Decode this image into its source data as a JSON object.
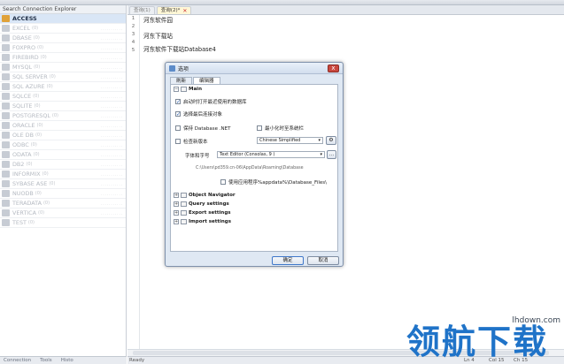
{
  "left_panel": {
    "title": "Search Connection Explorer",
    "items": [
      {
        "label": "ACCESS",
        "count": "",
        "selected": true,
        "tail": ""
      },
      {
        "label": "EXCEL",
        "count": "(0)",
        "selected": false,
        "tail": "..........."
      },
      {
        "label": "DBASE",
        "count": "(0)",
        "selected": false,
        "tail": "..........."
      },
      {
        "label": "FOXPRO",
        "count": "(0)",
        "selected": false,
        "tail": "..........."
      },
      {
        "label": "FIREBIRD",
        "count": "(0)",
        "selected": false,
        "tail": "..........."
      },
      {
        "label": "MYSQL",
        "count": "(0)",
        "selected": false,
        "tail": "..........."
      },
      {
        "label": "SQL SERVER",
        "count": "(0)",
        "selected": false,
        "tail": "..........."
      },
      {
        "label": "SQL AZURE",
        "count": "(0)",
        "selected": false,
        "tail": "..........."
      },
      {
        "label": "SQLCE",
        "count": "(0)",
        "selected": false,
        "tail": "..........."
      },
      {
        "label": "SQLITE",
        "count": "(0)",
        "selected": false,
        "tail": "..........."
      },
      {
        "label": "POSTGRESQL",
        "count": "(0)",
        "selected": false,
        "tail": "..........."
      },
      {
        "label": "ORACLE",
        "count": "(0)",
        "selected": false,
        "tail": "..........."
      },
      {
        "label": "OLE DB",
        "count": "(0)",
        "selected": false,
        "tail": "..........."
      },
      {
        "label": "ODBC",
        "count": "(0)",
        "selected": false,
        "tail": "..........."
      },
      {
        "label": "ODATA",
        "count": "(0)",
        "selected": false,
        "tail": "..........."
      },
      {
        "label": "DB2",
        "count": "(0)",
        "selected": false,
        "tail": "..........."
      },
      {
        "label": "INFORMIX",
        "count": "(0)",
        "selected": false,
        "tail": "..........."
      },
      {
        "label": "SYBASE ASE",
        "count": "(0)",
        "selected": false,
        "tail": "..........."
      },
      {
        "label": "NUODB",
        "count": "(0)",
        "selected": false,
        "tail": "..........."
      },
      {
        "label": "TERADATA",
        "count": "(0)",
        "selected": false,
        "tail": "..........."
      },
      {
        "label": "VERTICA",
        "count": "(0)",
        "selected": false,
        "tail": "..........."
      },
      {
        "label": "TEST",
        "count": "(0)",
        "selected": false,
        "tail": ""
      }
    ],
    "bottom_tabs": [
      "Connection",
      "Tools",
      "Histo"
    ]
  },
  "editor_tabs": [
    {
      "label": "查询(1)",
      "active": false
    },
    {
      "label": "查询(2)*",
      "active": true
    }
  ],
  "editor": {
    "line_numbers": [
      "1",
      "2",
      "3",
      "4",
      "5"
    ],
    "lines": [
      "河东软件园",
      "",
      "河东下载站",
      "",
      "河东软件下载站Database4"
    ]
  },
  "status_bar": {
    "left": "Ready",
    "ln": "Ln 4",
    "col": "Col 15",
    "ch": "Ch 15"
  },
  "dialog": {
    "title": "选项",
    "tabs": [
      {
        "label": "刷新",
        "active": false
      },
      {
        "label": "编辑器",
        "active": true
      }
    ],
    "main_section": "Main",
    "options": [
      {
        "label": "启动时打开最近使用的数据库",
        "checked": true
      },
      {
        "label": "选择最后连接对象",
        "checked": true
      },
      {
        "label": "保持 Database .NET",
        "checked": false
      },
      {
        "label": "最小化时至系统栏",
        "checked": false
      },
      {
        "label": "检查新版本",
        "checked": false
      },
      {
        "label": "使用应用程序%appdata%\\Database_Files\\",
        "checked": false
      }
    ],
    "language_value": "Chinese Simplified",
    "font_label": "字体和字号",
    "font_value": "Text Editor (Consolas, 9 )",
    "browse_label": "...",
    "path_text": "C:\\Users\\pd359.cn-06\\AppData\\Roaming\\Database",
    "sections": [
      "Object Navigator",
      "Query settings",
      "Export settings",
      "Import settings"
    ],
    "ok_label": "确定",
    "cancel_label": "取消",
    "close_label": "x"
  },
  "watermark": {
    "site": "lhdown.com",
    "text": "领航下载"
  }
}
